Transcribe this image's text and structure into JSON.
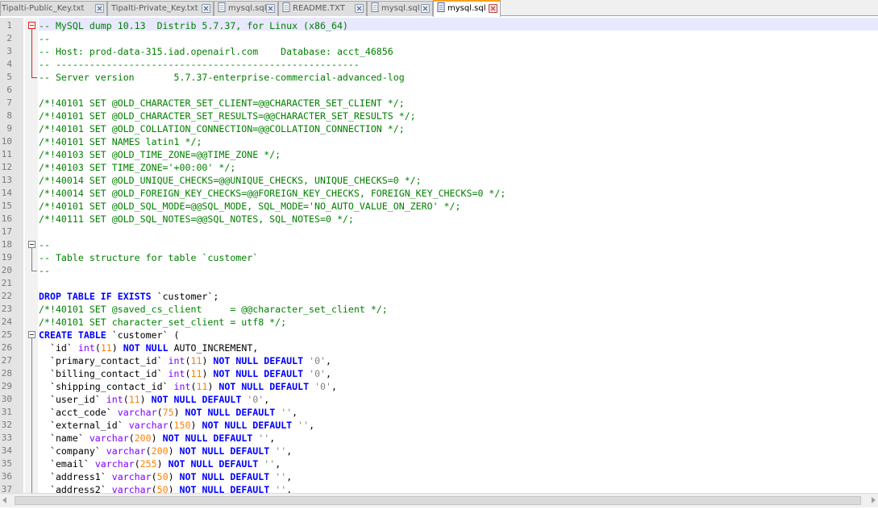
{
  "tabs": [
    {
      "label": "Tipalti-Public_Key.txt",
      "active": false
    },
    {
      "label": "Tipalti-Private_Key.txt",
      "active": false
    },
    {
      "label": "mysql.sql",
      "active": false
    },
    {
      "label": "README.TXT",
      "active": false
    },
    {
      "label": "mysql.sql",
      "active": false
    },
    {
      "label": "mysql.sql",
      "active": true
    }
  ],
  "colors": {
    "comment": "#008000",
    "keyword": "#0000ff",
    "number": "#ff8000",
    "type": "#8000ff",
    "string": "#808080",
    "active_tab_accent": "#f6a11b",
    "active_line": "#e8e8ff"
  },
  "icons": [
    "file-icon",
    "close-icon",
    "fold-icon",
    "scroll-left-icon",
    "scroll-right-icon"
  ],
  "editor": {
    "lines": [
      {
        "n": "1",
        "fold": "red-open",
        "tokens": [
          [
            "c",
            "-- MySQL dump 10.13  Distrib 5.7.37, for Linux (x86_64)"
          ]
        ]
      },
      {
        "n": "2",
        "fold": "red-line",
        "tokens": [
          [
            "c",
            "--"
          ]
        ]
      },
      {
        "n": "3",
        "fold": "red-line",
        "tokens": [
          [
            "c",
            "-- Host: prod-data-315.iad.openairl.com    Database: acct_46856"
          ]
        ]
      },
      {
        "n": "4",
        "fold": "red-line",
        "tokens": [
          [
            "c",
            "-- ------------------------------------------------------"
          ]
        ]
      },
      {
        "n": "5",
        "fold": "red-end",
        "tokens": [
          [
            "c",
            "-- Server version\t5.7.37-enterprise-commercial-advanced-log"
          ]
        ]
      },
      {
        "n": "6",
        "fold": "",
        "tokens": []
      },
      {
        "n": "7",
        "fold": "",
        "tokens": [
          [
            "c",
            "/*!40101 SET @OLD_CHARACTER_SET_CLIENT=@@CHARACTER_SET_CLIENT */;"
          ]
        ]
      },
      {
        "n": "8",
        "fold": "",
        "tokens": [
          [
            "c",
            "/*!40101 SET @OLD_CHARACTER_SET_RESULTS=@@CHARACTER_SET_RESULTS */;"
          ]
        ]
      },
      {
        "n": "9",
        "fold": "",
        "tokens": [
          [
            "c",
            "/*!40101 SET @OLD_COLLATION_CONNECTION=@@COLLATION_CONNECTION */;"
          ]
        ]
      },
      {
        "n": "10",
        "fold": "",
        "tokens": [
          [
            "c",
            "/*!40101 SET NAMES latin1 */;"
          ]
        ]
      },
      {
        "n": "11",
        "fold": "",
        "tokens": [
          [
            "c",
            "/*!40103 SET @OLD_TIME_ZONE=@@TIME_ZONE */;"
          ]
        ]
      },
      {
        "n": "12",
        "fold": "",
        "tokens": [
          [
            "c",
            "/*!40103 SET TIME_ZONE='+00:00' */;"
          ]
        ]
      },
      {
        "n": "13",
        "fold": "",
        "tokens": [
          [
            "c",
            "/*!40014 SET @OLD_UNIQUE_CHECKS=@@UNIQUE_CHECKS, UNIQUE_CHECKS=0 */;"
          ]
        ]
      },
      {
        "n": "14",
        "fold": "",
        "tokens": [
          [
            "c",
            "/*!40014 SET @OLD_FOREIGN_KEY_CHECKS=@@FOREIGN_KEY_CHECKS, FOREIGN_KEY_CHECKS=0 */;"
          ]
        ]
      },
      {
        "n": "15",
        "fold": "",
        "tokens": [
          [
            "c",
            "/*!40101 SET @OLD_SQL_MODE=@@SQL_MODE, SQL_MODE='NO_AUTO_VALUE_ON_ZERO' */;"
          ]
        ]
      },
      {
        "n": "16",
        "fold": "",
        "tokens": [
          [
            "c",
            "/*!40111 SET @OLD_SQL_NOTES=@@SQL_NOTES, SQL_NOTES=0 */;"
          ]
        ]
      },
      {
        "n": "17",
        "fold": "",
        "tokens": []
      },
      {
        "n": "18",
        "fold": "open",
        "tokens": [
          [
            "c",
            "--"
          ]
        ]
      },
      {
        "n": "19",
        "fold": "line",
        "tokens": [
          [
            "c",
            "-- Table structure for table `customer`"
          ]
        ]
      },
      {
        "n": "20",
        "fold": "end",
        "tokens": [
          [
            "c",
            "--"
          ]
        ]
      },
      {
        "n": "21",
        "fold": "",
        "tokens": []
      },
      {
        "n": "22",
        "fold": "",
        "tokens": [
          [
            "k",
            "DROP TABLE IF EXISTS"
          ],
          [
            "t",
            " `customer`;"
          ]
        ]
      },
      {
        "n": "23",
        "fold": "",
        "tokens": [
          [
            "c",
            "/*!40101 SET @saved_cs_client     = @@character_set_client */;"
          ]
        ]
      },
      {
        "n": "24",
        "fold": "",
        "tokens": [
          [
            "c",
            "/*!40101 SET character_set_client = utf8 */;"
          ]
        ]
      },
      {
        "n": "25",
        "fold": "open",
        "tokens": [
          [
            "k",
            "CREATE TABLE"
          ],
          [
            "t",
            " `customer` ("
          ]
        ]
      },
      {
        "n": "26",
        "fold": "line",
        "tokens": [
          [
            "t",
            "  `id` "
          ],
          [
            "y",
            "int"
          ],
          [
            "t",
            "("
          ],
          [
            "n",
            "11"
          ],
          [
            "t",
            ") "
          ],
          [
            "k",
            "NOT NULL"
          ],
          [
            "t",
            " AUTO_INCREMENT,"
          ]
        ]
      },
      {
        "n": "27",
        "fold": "line",
        "tokens": [
          [
            "t",
            "  `primary_contact_id` "
          ],
          [
            "y",
            "int"
          ],
          [
            "t",
            "("
          ],
          [
            "n",
            "11"
          ],
          [
            "t",
            ") "
          ],
          [
            "k",
            "NOT NULL DEFAULT"
          ],
          [
            "t",
            " "
          ],
          [
            "s",
            "'0'"
          ],
          [
            "t",
            ","
          ]
        ]
      },
      {
        "n": "28",
        "fold": "line",
        "tokens": [
          [
            "t",
            "  `billing_contact_id` "
          ],
          [
            "y",
            "int"
          ],
          [
            "t",
            "("
          ],
          [
            "n",
            "11"
          ],
          [
            "t",
            ") "
          ],
          [
            "k",
            "NOT NULL DEFAULT"
          ],
          [
            "t",
            " "
          ],
          [
            "s",
            "'0'"
          ],
          [
            "t",
            ","
          ]
        ]
      },
      {
        "n": "29",
        "fold": "line",
        "tokens": [
          [
            "t",
            "  `shipping_contact_id` "
          ],
          [
            "y",
            "int"
          ],
          [
            "t",
            "("
          ],
          [
            "n",
            "11"
          ],
          [
            "t",
            ") "
          ],
          [
            "k",
            "NOT NULL DEFAULT"
          ],
          [
            "t",
            " "
          ],
          [
            "s",
            "'0'"
          ],
          [
            "t",
            ","
          ]
        ]
      },
      {
        "n": "30",
        "fold": "line",
        "tokens": [
          [
            "t",
            "  `user_id` "
          ],
          [
            "y",
            "int"
          ],
          [
            "t",
            "("
          ],
          [
            "n",
            "11"
          ],
          [
            "t",
            ") "
          ],
          [
            "k",
            "NOT NULL DEFAULT"
          ],
          [
            "t",
            " "
          ],
          [
            "s",
            "'0'"
          ],
          [
            "t",
            ","
          ]
        ]
      },
      {
        "n": "31",
        "fold": "line",
        "tokens": [
          [
            "t",
            "  `acct_code` "
          ],
          [
            "y",
            "varchar"
          ],
          [
            "t",
            "("
          ],
          [
            "n",
            "75"
          ],
          [
            "t",
            ") "
          ],
          [
            "k",
            "NOT NULL DEFAULT"
          ],
          [
            "t",
            " "
          ],
          [
            "s",
            "''"
          ],
          [
            "t",
            ","
          ]
        ]
      },
      {
        "n": "32",
        "fold": "line",
        "tokens": [
          [
            "t",
            "  `external_id` "
          ],
          [
            "y",
            "varchar"
          ],
          [
            "t",
            "("
          ],
          [
            "n",
            "150"
          ],
          [
            "t",
            ") "
          ],
          [
            "k",
            "NOT NULL DEFAULT"
          ],
          [
            "t",
            " "
          ],
          [
            "s",
            "''"
          ],
          [
            "t",
            ","
          ]
        ]
      },
      {
        "n": "33",
        "fold": "line",
        "tokens": [
          [
            "t",
            "  `name` "
          ],
          [
            "y",
            "varchar"
          ],
          [
            "t",
            "("
          ],
          [
            "n",
            "200"
          ],
          [
            "t",
            ") "
          ],
          [
            "k",
            "NOT NULL DEFAULT"
          ],
          [
            "t",
            " "
          ],
          [
            "s",
            "''"
          ],
          [
            "t",
            ","
          ]
        ]
      },
      {
        "n": "34",
        "fold": "line",
        "tokens": [
          [
            "t",
            "  `company` "
          ],
          [
            "y",
            "varchar"
          ],
          [
            "t",
            "("
          ],
          [
            "n",
            "200"
          ],
          [
            "t",
            ") "
          ],
          [
            "k",
            "NOT NULL DEFAULT"
          ],
          [
            "t",
            " "
          ],
          [
            "s",
            "''"
          ],
          [
            "t",
            ","
          ]
        ]
      },
      {
        "n": "35",
        "fold": "line",
        "tokens": [
          [
            "t",
            "  `email` "
          ],
          [
            "y",
            "varchar"
          ],
          [
            "t",
            "("
          ],
          [
            "n",
            "255"
          ],
          [
            "t",
            ") "
          ],
          [
            "k",
            "NOT NULL DEFAULT"
          ],
          [
            "t",
            " "
          ],
          [
            "s",
            "''"
          ],
          [
            "t",
            ","
          ]
        ]
      },
      {
        "n": "36",
        "fold": "line",
        "tokens": [
          [
            "t",
            "  `address1` "
          ],
          [
            "y",
            "varchar"
          ],
          [
            "t",
            "("
          ],
          [
            "n",
            "50"
          ],
          [
            "t",
            ") "
          ],
          [
            "k",
            "NOT NULL DEFAULT"
          ],
          [
            "t",
            " "
          ],
          [
            "s",
            "''"
          ],
          [
            "t",
            ","
          ]
        ]
      },
      {
        "n": "37",
        "fold": "line",
        "tokens": [
          [
            "t",
            "  `address2` "
          ],
          [
            "y",
            "varchar"
          ],
          [
            "t",
            "("
          ],
          [
            "n",
            "50"
          ],
          [
            "t",
            ") "
          ],
          [
            "k",
            "NOT NULL DEFAULT"
          ],
          [
            "t",
            " "
          ],
          [
            "s",
            "''"
          ],
          [
            "t",
            ","
          ]
        ]
      }
    ]
  }
}
